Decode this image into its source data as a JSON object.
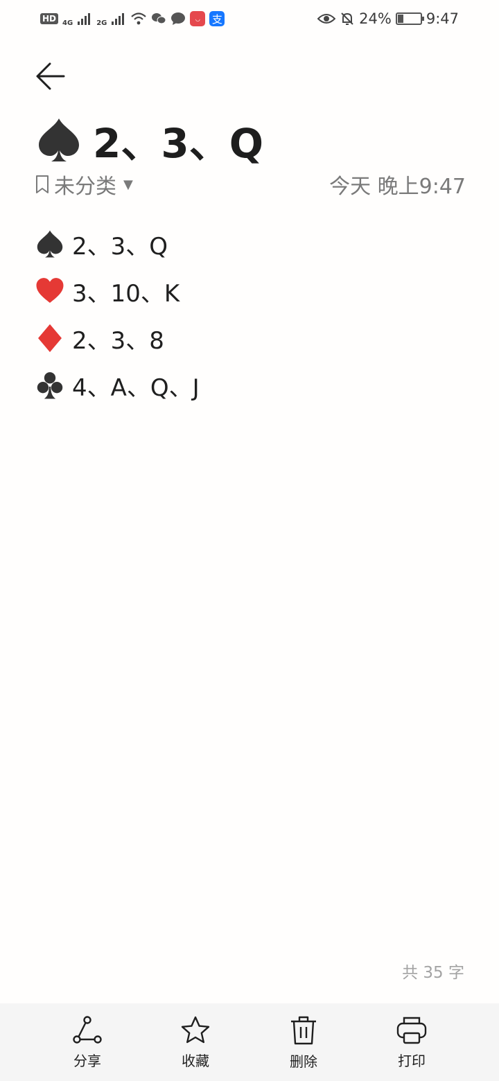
{
  "status_bar": {
    "left_badges": {
      "hd": "HD",
      "net1": "4G",
      "net2": "2G"
    },
    "battery": "24%",
    "time": "9:47",
    "battery_level": 0.24,
    "icons": [
      "hd-icon",
      "signal-icon",
      "wifi-icon",
      "wechat-icon",
      "message-icon",
      "huawei-icon",
      "alipay-icon",
      "eye-icon",
      "mute-bell-icon",
      "battery-icon"
    ]
  },
  "note": {
    "title_text": "2、3、Q",
    "title_suit": "♠",
    "category": "未分类",
    "timestamp": "今天 晚上9:47",
    "lines": [
      {
        "suit": "♠",
        "suit_color": "#333333",
        "text": "2、3、Q"
      },
      {
        "suit": "❤",
        "suit_color": "#e53935",
        "text": "3、10、K"
      },
      {
        "suit": "♦",
        "suit_color": "#e53935",
        "text": "2、3、8"
      },
      {
        "suit": "♣",
        "suit_color": "#333333",
        "text": "4、A、Q、J"
      }
    ],
    "word_count": "共 35 字"
  },
  "toolbar": {
    "share_label": "分享",
    "favorite_label": "收藏",
    "delete_label": "删除",
    "print_label": "打印"
  },
  "colors": {
    "accent_red": "#e53935",
    "text_dark": "#1f1f1f",
    "text_muted": "#7a7a7a",
    "toolbar_bg": "#f5f5f5"
  }
}
